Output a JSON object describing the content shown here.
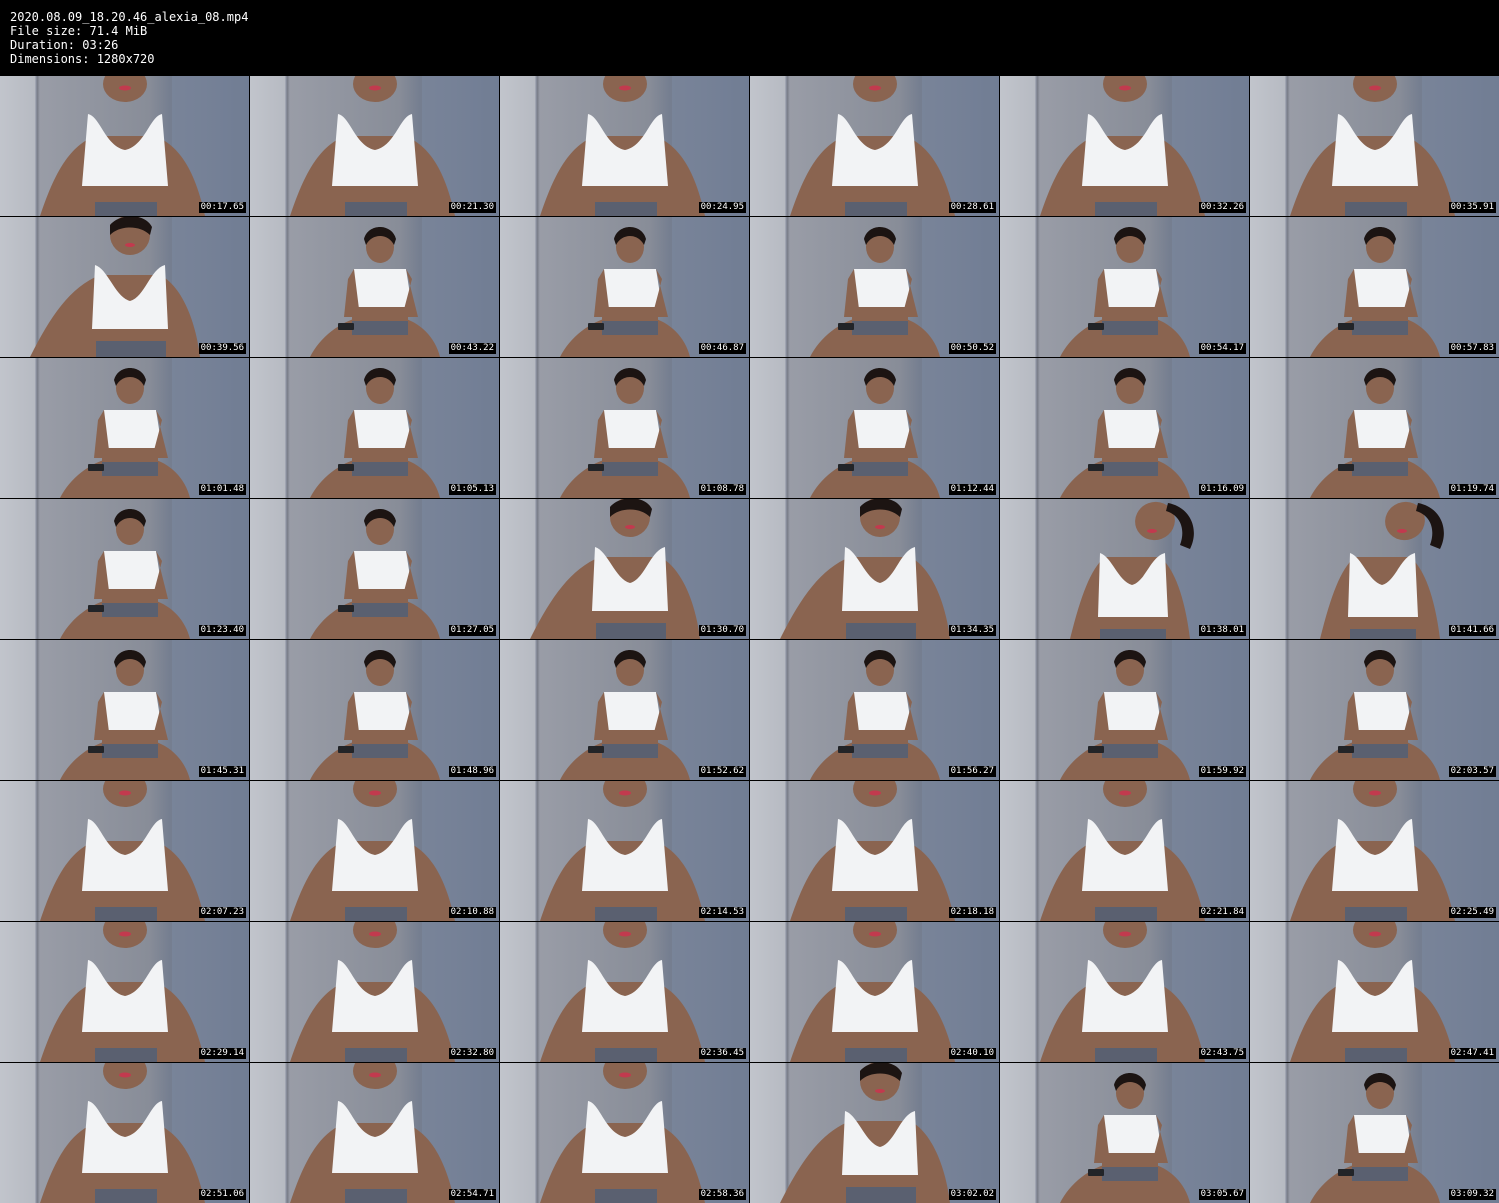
{
  "header": {
    "filename": "2020.08.09_18.20.46_alexia_08.mp4",
    "file_size": "File size: 71.4 MiB",
    "duration": "Duration: 03:26",
    "dimensions": "Dimensions: 1280x720"
  },
  "frames": [
    {
      "time": "00:17.65",
      "pose": "close"
    },
    {
      "time": "00:21.30",
      "pose": "close"
    },
    {
      "time": "00:24.95",
      "pose": "close"
    },
    {
      "time": "00:28.61",
      "pose": "close"
    },
    {
      "time": "00:32.26",
      "pose": "close"
    },
    {
      "time": "00:35.91",
      "pose": "close"
    },
    {
      "time": "00:39.56",
      "pose": "lean"
    },
    {
      "time": "00:43.22",
      "pose": "seated"
    },
    {
      "time": "00:46.87",
      "pose": "seated"
    },
    {
      "time": "00:50.52",
      "pose": "seated"
    },
    {
      "time": "00:54.17",
      "pose": "seated"
    },
    {
      "time": "00:57.83",
      "pose": "seated"
    },
    {
      "time": "01:01.48",
      "pose": "seated"
    },
    {
      "time": "01:05.13",
      "pose": "seated"
    },
    {
      "time": "01:08.78",
      "pose": "seated"
    },
    {
      "time": "01:12.44",
      "pose": "seated"
    },
    {
      "time": "01:16.09",
      "pose": "seated"
    },
    {
      "time": "01:19.74",
      "pose": "seated"
    },
    {
      "time": "01:23.40",
      "pose": "seated"
    },
    {
      "time": "01:27.05",
      "pose": "seated"
    },
    {
      "time": "01:30.70",
      "pose": "lean"
    },
    {
      "time": "01:34.35",
      "pose": "lean"
    },
    {
      "time": "01:38.01",
      "pose": "tilt"
    },
    {
      "time": "01:41.66",
      "pose": "tilt"
    },
    {
      "time": "01:45.31",
      "pose": "seated"
    },
    {
      "time": "01:48.96",
      "pose": "seated"
    },
    {
      "time": "01:52.62",
      "pose": "seated"
    },
    {
      "time": "01:56.27",
      "pose": "seated"
    },
    {
      "time": "01:59.92",
      "pose": "seated"
    },
    {
      "time": "02:03.57",
      "pose": "seated"
    },
    {
      "time": "02:07.23",
      "pose": "close"
    },
    {
      "time": "02:10.88",
      "pose": "close"
    },
    {
      "time": "02:14.53",
      "pose": "close"
    },
    {
      "time": "02:18.18",
      "pose": "close"
    },
    {
      "time": "02:21.84",
      "pose": "close"
    },
    {
      "time": "02:25.49",
      "pose": "close"
    },
    {
      "time": "02:29.14",
      "pose": "close"
    },
    {
      "time": "02:32.80",
      "pose": "close"
    },
    {
      "time": "02:36.45",
      "pose": "close"
    },
    {
      "time": "02:40.10",
      "pose": "close"
    },
    {
      "time": "02:43.75",
      "pose": "close"
    },
    {
      "time": "02:47.41",
      "pose": "close"
    },
    {
      "time": "02:51.06",
      "pose": "close"
    },
    {
      "time": "02:54.71",
      "pose": "close"
    },
    {
      "time": "02:58.36",
      "pose": "close"
    },
    {
      "time": "03:02.02",
      "pose": "lean"
    },
    {
      "time": "03:05.67",
      "pose": "seated"
    },
    {
      "time": "03:09.32",
      "pose": "seated"
    }
  ],
  "colors": {
    "background": "#000000",
    "text": "#ffffff",
    "wall": "#b4b9c6",
    "skin": "#8a6450",
    "top": "#f2f3f5",
    "shorts": "#5a6070",
    "hair": "#1c1412"
  }
}
